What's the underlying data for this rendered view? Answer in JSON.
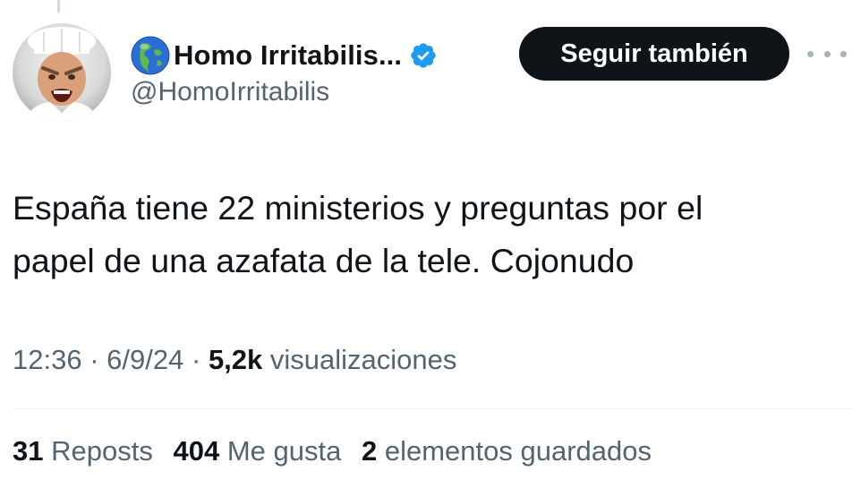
{
  "tweet": {
    "author": {
      "name": "Homo Irritabilis...",
      "handle": "@HomoIrritabilis",
      "verified": true,
      "avatar_icon": "angry-chef-avatar",
      "name_emoji": "globe-americas-icon"
    },
    "follow_label": "Seguir también",
    "more_icon": "more-options-icon",
    "text_line1": "España tiene 22 ministerios y preguntas por el",
    "text_line2": "papel de una azafata de la tele. Cojonudo",
    "time": "12:36",
    "date": "6/9/24",
    "views_count": "5,2k",
    "views_label": "visualizaciones",
    "separator": "·",
    "stats": {
      "reposts_count": "31",
      "reposts_label": "Reposts",
      "likes_count": "404",
      "likes_label": "Me gusta",
      "bookmarks_count": "2",
      "bookmarks_label": "elementos guardados"
    }
  },
  "colors": {
    "text_primary": "#0f1419",
    "text_secondary": "#536471",
    "verified_blue": "#1d9bf0",
    "button_bg": "#0f1419",
    "divider": "#eff3f4"
  }
}
